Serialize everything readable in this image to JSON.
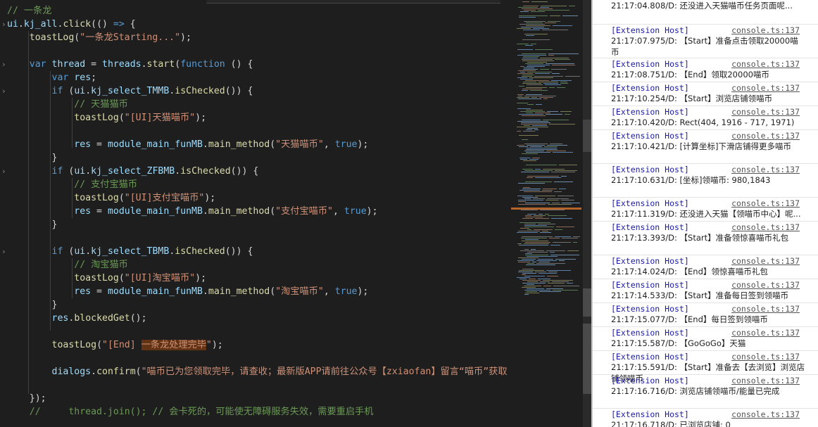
{
  "editor": {
    "lines": [
      [
        [
          "cmt",
          "// 一条龙"
        ]
      ],
      [
        [
          "var",
          "ui"
        ],
        [
          "pl",
          "."
        ],
        [
          "var",
          "kj_all"
        ],
        [
          "pl",
          "."
        ],
        [
          "fn",
          "click"
        ],
        [
          "pl",
          "(() "
        ],
        [
          "kw",
          "=>"
        ],
        [
          "pl",
          " {"
        ]
      ],
      [
        [
          "pl",
          "    "
        ],
        [
          "fn",
          "toastLog"
        ],
        [
          "pl",
          "("
        ],
        [
          "str",
          "\"一条龙Starting...\""
        ],
        [
          "pl",
          ");"
        ]
      ],
      [
        [
          "pl",
          ""
        ]
      ],
      [
        [
          "pl",
          "    "
        ],
        [
          "kw",
          "var"
        ],
        [
          "pl",
          " "
        ],
        [
          "var",
          "thread"
        ],
        [
          "pl",
          " = "
        ],
        [
          "var",
          "threads"
        ],
        [
          "pl",
          "."
        ],
        [
          "fn",
          "start"
        ],
        [
          "pl",
          "("
        ],
        [
          "kw",
          "function"
        ],
        [
          "pl",
          " () {"
        ]
      ],
      [
        [
          "pl",
          "        "
        ],
        [
          "kw",
          "var"
        ],
        [
          "pl",
          " "
        ],
        [
          "var",
          "res"
        ],
        [
          "pl",
          ";"
        ]
      ],
      [
        [
          "pl",
          "        "
        ],
        [
          "kw",
          "if"
        ],
        [
          "pl",
          " ("
        ],
        [
          "var",
          "ui"
        ],
        [
          "pl",
          "."
        ],
        [
          "var",
          "kj_select_TMMB"
        ],
        [
          "pl",
          "."
        ],
        [
          "fn",
          "isChecked"
        ],
        [
          "pl",
          "()) {"
        ]
      ],
      [
        [
          "pl",
          "            "
        ],
        [
          "cmt",
          "// 天猫猫币"
        ]
      ],
      [
        [
          "pl",
          "            "
        ],
        [
          "fn",
          "toastLog"
        ],
        [
          "pl",
          "("
        ],
        [
          "str",
          "\"[UI]天猫喵币\""
        ],
        [
          "pl",
          ");"
        ]
      ],
      [
        [
          "pl",
          ""
        ]
      ],
      [
        [
          "pl",
          "            "
        ],
        [
          "var",
          "res"
        ],
        [
          "pl",
          " = "
        ],
        [
          "var",
          "module_main_funMB"
        ],
        [
          "pl",
          "."
        ],
        [
          "fn",
          "main_method"
        ],
        [
          "pl",
          "("
        ],
        [
          "str",
          "\"天猫喵币\""
        ],
        [
          "pl",
          ", "
        ],
        [
          "kw",
          "true"
        ],
        [
          "pl",
          ");"
        ]
      ],
      [
        [
          "pl",
          "        }"
        ]
      ],
      [
        [
          "pl",
          "        "
        ],
        [
          "kw",
          "if"
        ],
        [
          "pl",
          " ("
        ],
        [
          "var",
          "ui"
        ],
        [
          "pl",
          "."
        ],
        [
          "var",
          "kj_select_ZFBMB"
        ],
        [
          "pl",
          "."
        ],
        [
          "fn",
          "isChecked"
        ],
        [
          "pl",
          "()) {"
        ]
      ],
      [
        [
          "pl",
          "            "
        ],
        [
          "cmt",
          "// 支付宝猫币"
        ]
      ],
      [
        [
          "pl",
          "            "
        ],
        [
          "fn",
          "toastLog"
        ],
        [
          "pl",
          "("
        ],
        [
          "str",
          "\"[UI]支付宝喵币\""
        ],
        [
          "pl",
          ");"
        ]
      ],
      [
        [
          "pl",
          "            "
        ],
        [
          "var",
          "res"
        ],
        [
          "pl",
          " = "
        ],
        [
          "var",
          "module_main_funMB"
        ],
        [
          "pl",
          "."
        ],
        [
          "fn",
          "main_method"
        ],
        [
          "pl",
          "("
        ],
        [
          "str",
          "\"支付宝喵币\""
        ],
        [
          "pl",
          ", "
        ],
        [
          "kw",
          "true"
        ],
        [
          "pl",
          ");"
        ]
      ],
      [
        [
          "pl",
          "        }"
        ]
      ],
      [
        [
          "pl",
          ""
        ]
      ],
      [
        [
          "pl",
          "        "
        ],
        [
          "kw",
          "if"
        ],
        [
          "pl",
          " ("
        ],
        [
          "var",
          "ui"
        ],
        [
          "pl",
          "."
        ],
        [
          "var",
          "kj_select_TBMB"
        ],
        [
          "pl",
          "."
        ],
        [
          "fn",
          "isChecked"
        ],
        [
          "pl",
          "()) {"
        ]
      ],
      [
        [
          "pl",
          "            "
        ],
        [
          "cmt",
          "// 淘宝猫币"
        ]
      ],
      [
        [
          "pl",
          "            "
        ],
        [
          "fn",
          "toastLog"
        ],
        [
          "pl",
          "("
        ],
        [
          "str",
          "\"[UI]淘宝喵币\""
        ],
        [
          "pl",
          ");"
        ]
      ],
      [
        [
          "pl",
          "            "
        ],
        [
          "var",
          "res"
        ],
        [
          "pl",
          " = "
        ],
        [
          "var",
          "module_main_funMB"
        ],
        [
          "pl",
          "."
        ],
        [
          "fn",
          "main_method"
        ],
        [
          "pl",
          "("
        ],
        [
          "str",
          "\"淘宝喵币\""
        ],
        [
          "pl",
          ", "
        ],
        [
          "kw",
          "true"
        ],
        [
          "pl",
          ");"
        ]
      ],
      [
        [
          "pl",
          "        }"
        ]
      ],
      [
        [
          "pl",
          "        "
        ],
        [
          "var",
          "res"
        ],
        [
          "pl",
          "."
        ],
        [
          "fn",
          "blockedGet"
        ],
        [
          "pl",
          "();"
        ]
      ],
      [
        [
          "pl",
          ""
        ]
      ],
      [
        [
          "pl",
          "        "
        ],
        [
          "fn",
          "toastLog"
        ],
        [
          "pl",
          "("
        ],
        [
          "str",
          "\"[End] "
        ],
        [
          "hl",
          "一条龙处理完毕"
        ],
        [
          "str",
          "\""
        ],
        [
          "pl",
          ");"
        ]
      ],
      [
        [
          "pl",
          ""
        ]
      ],
      [
        [
          "pl",
          "        "
        ],
        [
          "var",
          "dialogs"
        ],
        [
          "pl",
          "."
        ],
        [
          "fn",
          "confirm"
        ],
        [
          "pl",
          "("
        ],
        [
          "str",
          "\"喵币已为您领取完毕，请查收；最新版APP请前往公众号【zxiaofan】留言“喵币”获取"
        ]
      ],
      [
        [
          "pl",
          ""
        ]
      ],
      [
        [
          "pl",
          "    });"
        ]
      ],
      [
        [
          "pl",
          "    "
        ],
        [
          "cmt",
          "//     thread.join(); // 会卡死的，可能使无障碍服务失效，需要重启手机"
        ]
      ]
    ]
  },
  "console": {
    "source_label": "[Extension Host]",
    "link_label": "console.ts:137",
    "first_message": "21:17:04.808/D: 还没进入天猫喵币任务页面呢...",
    "entries": [
      {
        "msg": "21:17:07.975/D: 【Start】准备点击领取20000喵币"
      },
      {
        "msg": "21:17:08.751/D: 【End】领取20000喵币"
      },
      {
        "msg": "21:17:10.254/D: 【Start】浏览店铺领喵币"
      },
      {
        "msg": "21:17:10.420/D: Rect(404, 1916 - 717, 1971)"
      },
      {
        "msg": "21:17:10.421/D: [计算坐标]下滑店铺得更多喵币"
      },
      {
        "msg": "21:17:10.631/D: [坐标]领喵币: 980,1843"
      },
      {
        "msg": "21:17:11.319/D: 还没进入天猫【领喵币中心】呢..."
      },
      {
        "msg": "21:17:13.393/D: 【Start】准备领惊喜喵币礼包"
      },
      {
        "msg": "21:17:14.024/D: 【End】领惊喜喵币礼包"
      },
      {
        "msg": "21:17:14.533/D: 【Start】准备每日签到领喵币"
      },
      {
        "msg": "21:17:15.077/D: 【End】每日签到领喵币"
      },
      {
        "msg": "21:17:15.587/D: 【GoGoGo】天猫"
      },
      {
        "msg": "21:17:15.591/D: 【Start】准备去【去浏览】浏览店铺领喵币"
      },
      {
        "msg": "21:17:16.716/D: 浏览店铺领喵币/能量已完成"
      },
      {
        "msg": "21:17:16.718/D: 已浏览店铺: 0"
      }
    ]
  },
  "colors": {
    "editor_bg": "#1e1e1e",
    "comment": "#6a9955",
    "keyword": "#569cd6",
    "string": "#ce9178",
    "function": "#dcdcaa",
    "variable": "#9cdcfe",
    "console_source": "#1a1aa6"
  }
}
